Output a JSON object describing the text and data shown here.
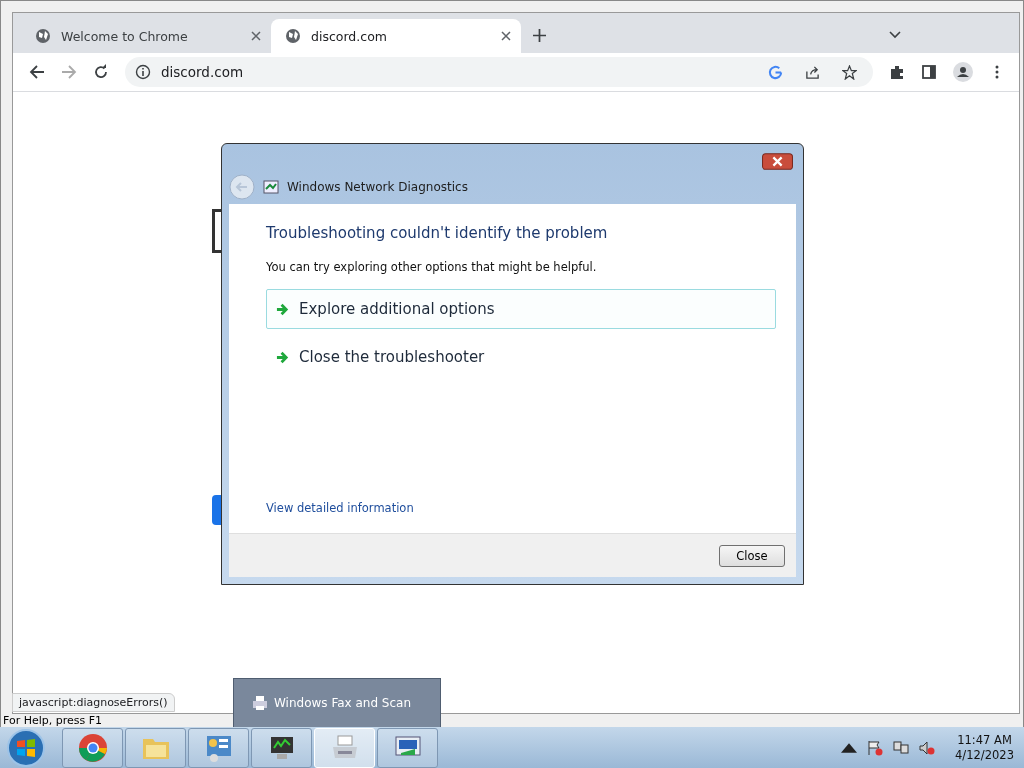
{
  "background_window": {
    "status": "For Help, press F1"
  },
  "browser": {
    "tabs": [
      {
        "title": "Welcome to Chrome",
        "selected": false
      },
      {
        "title": "discord.com",
        "selected": true
      }
    ],
    "address": "discord.com",
    "status_link": "javascript:diagnoseErrors()"
  },
  "dialog": {
    "title": "Windows Network Diagnostics",
    "heading": "Troubleshooting couldn't identify the problem",
    "message": "You can try exploring other options that might be helpful.",
    "options": [
      {
        "label": "Explore additional options",
        "selected": true
      },
      {
        "label": "Close the troubleshooter",
        "selected": false
      }
    ],
    "details_link": "View detailed information",
    "close_button": "Close"
  },
  "taskbar": {
    "preview": "Windows Fax and Scan",
    "apps": [
      {
        "kind": "chrome",
        "selected": false
      },
      {
        "kind": "folder",
        "selected": false
      },
      {
        "kind": "control-panel",
        "selected": false
      },
      {
        "kind": "monitor",
        "selected": false
      },
      {
        "kind": "fax",
        "selected": true
      },
      {
        "kind": "network",
        "selected": false
      }
    ],
    "time": "11:47 AM",
    "date": "4/12/2023"
  }
}
